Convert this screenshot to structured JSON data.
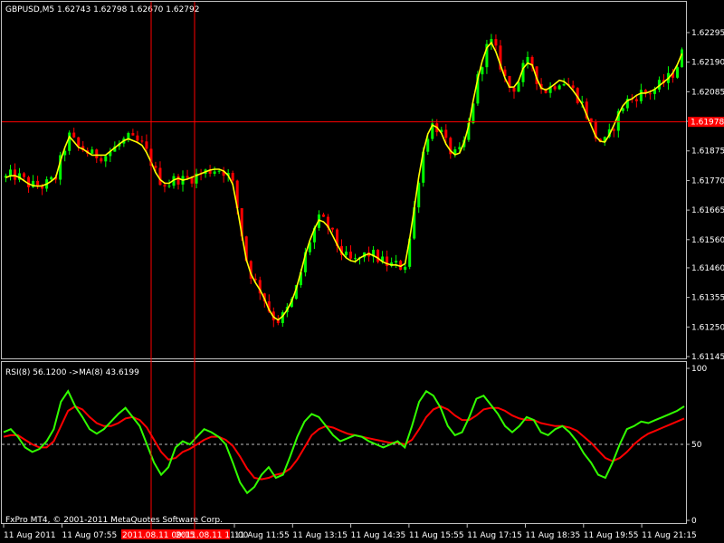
{
  "colors": {
    "background": "#000000",
    "axis": "#c0c0c0",
    "text": "#ffffff",
    "bull": "#00ff00",
    "bear": "#ff0000",
    "ma": "#ffff00",
    "rsi": "#32ff00",
    "rsi_ma": "#ff0000",
    "crosshair": "#ff0000"
  },
  "chart_data": [
    {
      "type": "candlestick",
      "title": "GBPUSD,M5  1.62743 1.62798 1.62670 1.62792",
      "ylim": [
        1.61145,
        1.62295
      ],
      "y_ticks": [
        "1.62295",
        "1.62190",
        "1.62085",
        "1.61980",
        "1.61875",
        "1.61770",
        "1.61665",
        "1.61560",
        "1.61460",
        "1.61355",
        "1.61250",
        "1.61145"
      ],
      "current_price_label": "1.61978",
      "current_price": 1.61978,
      "overlay_series": [
        {
          "type": "line"
        }
      ],
      "price_path": [
        1.6178,
        1.6179,
        1.6178,
        1.6176,
        1.6175,
        1.6175,
        1.6176,
        1.6178,
        1.6187,
        1.6193,
        1.6189,
        1.6188,
        1.6186,
        1.6186,
        1.6186,
        1.6188,
        1.619,
        1.6192,
        1.6191,
        1.619,
        1.6186,
        1.618,
        1.6176,
        1.6176,
        1.6178,
        1.6177,
        1.6178,
        1.6179,
        1.618,
        1.6181,
        1.6181,
        1.618,
        1.6175,
        1.616,
        1.6146,
        1.6141,
        1.6137,
        1.6131,
        1.6127,
        1.6129,
        1.6133,
        1.614,
        1.615,
        1.6158,
        1.6163,
        1.6162,
        1.6157,
        1.6152,
        1.6149,
        1.6148,
        1.615,
        1.6151,
        1.615,
        1.6148,
        1.6147,
        1.6147,
        1.6146,
        1.616,
        1.6178,
        1.6192,
        1.6197,
        1.6195,
        1.6189,
        1.6186,
        1.6187,
        1.6196,
        1.621,
        1.622,
        1.6227,
        1.6222,
        1.6214,
        1.6209,
        1.6212,
        1.6219,
        1.6218,
        1.621,
        1.6209,
        1.6211,
        1.6213,
        1.6211,
        1.6208,
        1.6204,
        1.6198,
        1.6192,
        1.619,
        1.6194,
        1.62,
        1.6205,
        1.6206,
        1.6208,
        1.6208,
        1.6209,
        1.6211,
        1.6213,
        1.6216,
        1.6222
      ]
    },
    {
      "type": "line",
      "title": "RSI(8) 56.1200  ->MA(8) 43.6199",
      "ylim": [
        0,
        100
      ],
      "y_ticks": [
        "100",
        "50",
        "0"
      ],
      "level": 50,
      "series": [
        {
          "values": [
            58,
            60,
            55,
            48,
            45,
            47,
            52,
            60,
            78,
            85,
            75,
            68,
            60,
            57,
            60,
            65,
            70,
            74,
            68,
            62,
            50,
            38,
            30,
            35,
            48,
            52,
            50,
            55,
            60,
            58,
            55,
            50,
            38,
            25,
            18,
            22,
            30,
            35,
            28,
            30,
            42,
            55,
            65,
            70,
            68,
            62,
            56,
            52,
            54,
            56,
            55,
            52,
            50,
            48,
            50,
            52,
            48,
            62,
            78,
            85,
            82,
            74,
            62,
            56,
            58,
            68,
            80,
            82,
            76,
            70,
            62,
            58,
            62,
            68,
            66,
            58,
            56,
            60,
            62,
            58,
            52,
            44,
            38,
            30,
            28,
            38,
            50,
            60,
            62,
            65,
            64,
            66,
            68,
            70,
            72,
            75
          ]
        },
        {
          "values": [
            55,
            56,
            56,
            53,
            50,
            48,
            48,
            52,
            62,
            72,
            75,
            73,
            68,
            64,
            62,
            62,
            64,
            67,
            68,
            66,
            61,
            53,
            45,
            40,
            41,
            45,
            47,
            50,
            53,
            55,
            55,
            53,
            49,
            42,
            34,
            28,
            27,
            28,
            30,
            31,
            34,
            40,
            48,
            56,
            60,
            62,
            61,
            59,
            57,
            56,
            55,
            54,
            53,
            52,
            51,
            51,
            50,
            53,
            60,
            68,
            73,
            75,
            73,
            69,
            66,
            66,
            69,
            73,
            74,
            74,
            72,
            69,
            67,
            66,
            66,
            64,
            63,
            62,
            62,
            61,
            59,
            55,
            51,
            46,
            41,
            39,
            41,
            45,
            50,
            54,
            57,
            59,
            61,
            63,
            65,
            67
          ]
        }
      ]
    }
  ],
  "x_labels": [
    "11 Aug 2011",
    "11 Aug 07:55",
    "11 Aug 11:55",
    "11 Aug 13:15",
    "11 Aug 14:35",
    "11 Aug 15:55",
    "11 Aug 17:15",
    "11 Aug 18:35",
    "11 Aug 19:55",
    "11 Aug 21:15"
  ],
  "crosshair_labels": [
    "2011.08.11 09:15",
    "2011.08.11 11:00"
  ],
  "footer": "FxPro MT4, © 2001-2011 MetaQuotes Software Corp."
}
